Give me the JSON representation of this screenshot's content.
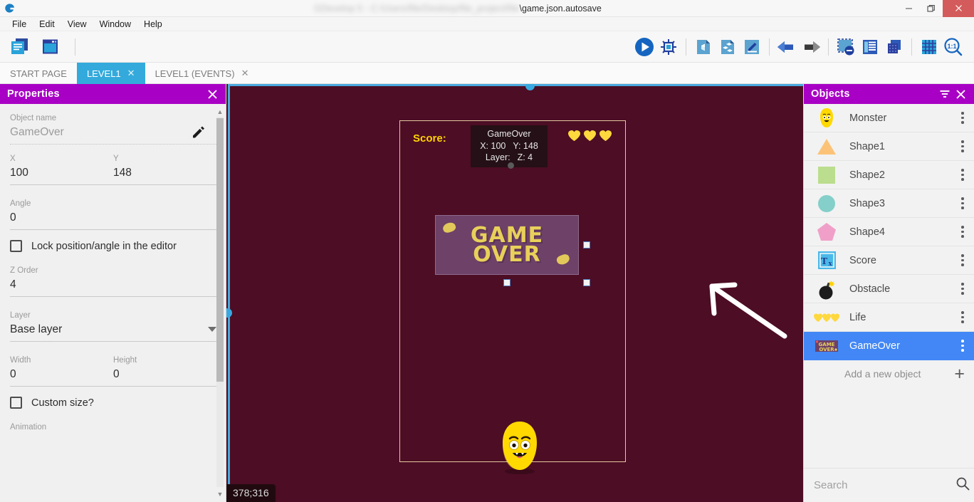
{
  "window": {
    "title_redacted": "GDevelop 5  -  C:/Users/file/Desktop/file_project/file",
    "title_visible": "\\game.json.autosave",
    "logo_icon": "gdevelop-logo-icon",
    "minimize_label": "—",
    "restore_label": "❐",
    "close_label": "✕"
  },
  "menubar": {
    "items": [
      {
        "label": "File",
        "name": "menu-file"
      },
      {
        "label": "Edit",
        "name": "menu-edit"
      },
      {
        "label": "View",
        "name": "menu-view"
      },
      {
        "label": "Window",
        "name": "menu-window"
      },
      {
        "label": "Help",
        "name": "menu-help"
      }
    ]
  },
  "toolbar": {
    "left": [
      {
        "name": "project-manager-icon",
        "title": "Project manager"
      },
      {
        "name": "scene-editor-icon",
        "title": "Scene editor"
      }
    ],
    "right": [
      {
        "name": "preview-play-icon",
        "title": "Preview"
      },
      {
        "name": "debug-preview-icon",
        "title": "Debug preview"
      },
      {
        "name": "add-scene-icon",
        "title": "Add scene"
      },
      {
        "name": "add-object-icon",
        "title": "Add object"
      },
      {
        "name": "edit-properties-icon",
        "title": "Edit properties"
      },
      {
        "name": "undo-icon",
        "title": "Undo"
      },
      {
        "name": "redo-icon",
        "title": "Redo"
      },
      {
        "name": "deselect-icon",
        "title": "Deselect"
      },
      {
        "name": "object-list-icon",
        "title": "Objects list"
      },
      {
        "name": "layers-icon",
        "title": "Layers"
      },
      {
        "name": "grid-icon",
        "title": "Toggle grid"
      },
      {
        "name": "zoom-reset-icon",
        "title": "Reset zoom",
        "label": "1:1"
      }
    ]
  },
  "tabs": [
    {
      "label": "START PAGE",
      "active": false,
      "closable": false,
      "name": "tab-start-page"
    },
    {
      "label": "LEVEL1",
      "active": true,
      "closable": true,
      "name": "tab-level1"
    },
    {
      "label": "LEVEL1 (EVENTS)",
      "active": false,
      "closable": true,
      "name": "tab-level1-events"
    }
  ],
  "properties": {
    "title": "Properties",
    "close_label": "✕",
    "object_name_label": "Object name",
    "object_name_value": "GameOver",
    "edit_icon": "pencil-icon",
    "x_label": "X",
    "x_value": "100",
    "y_label": "Y",
    "y_value": "148",
    "angle_label": "Angle",
    "angle_value": "0",
    "lock_label": "Lock position/angle in the editor",
    "lock_checked": false,
    "zorder_label": "Z Order",
    "zorder_value": "4",
    "layer_label": "Layer",
    "layer_value": "Base layer",
    "width_label": "Width",
    "width_value": "0",
    "height_label": "Height",
    "height_value": "0",
    "custom_size_label": "Custom size?",
    "custom_size_checked": false,
    "animation_label": "Animation"
  },
  "canvas": {
    "background_color": "#4d0d24",
    "scene_border_color": "#e3c9a0",
    "score_text": "Score:",
    "score_color": "#ffd400",
    "hearts_count": 3,
    "heart_color": "#ffd83d",
    "gameover_line1": "GAME",
    "gameover_line2": "OVER",
    "gameover_bg": "#6e4168",
    "gameover_text_color": "#e8d05a",
    "tooltip": {
      "name": "GameOver",
      "x_label": "X: 100",
      "y_label": "Y: 148",
      "layer_label": "Layer:",
      "z_label": "Z: 4"
    },
    "coordinates_badge": "378;316",
    "annotation_arrow": "white-arrow-annotation"
  },
  "objects": {
    "title": "Objects",
    "filter_icon": "filter-icon",
    "close_label": "✕",
    "items": [
      {
        "label": "Monster",
        "thumb": "monster-thumb-icon",
        "selected": false
      },
      {
        "label": "Shape1",
        "thumb": "triangle-thumb-icon",
        "selected": false
      },
      {
        "label": "Shape2",
        "thumb": "square-thumb-icon",
        "selected": false
      },
      {
        "label": "Shape3",
        "thumb": "circle-thumb-icon",
        "selected": false
      },
      {
        "label": "Shape4",
        "thumb": "pentagon-thumb-icon",
        "selected": false
      },
      {
        "label": "Score",
        "thumb": "text-object-thumb-icon",
        "selected": false
      },
      {
        "label": "Obstacle",
        "thumb": "bomb-thumb-icon",
        "selected": false
      },
      {
        "label": "Life",
        "thumb": "hearts-thumb-icon",
        "selected": false
      },
      {
        "label": "GameOver",
        "thumb": "gameover-thumb-icon",
        "selected": true
      }
    ],
    "add_label": "Add a new object",
    "add_icon": "plus-icon",
    "search_placeholder": "Search",
    "search_value": "",
    "search_icon": "search-icon"
  },
  "colors": {
    "panel_header": "#a800c4",
    "tab_active": "#34aadc",
    "selection_blue": "#4287f5",
    "canvas_handle": "#38a9e0"
  }
}
